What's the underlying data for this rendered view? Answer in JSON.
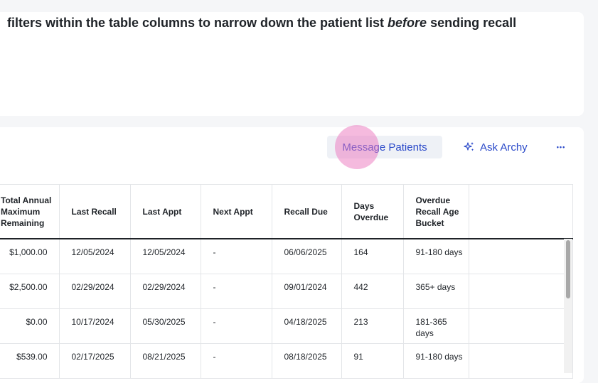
{
  "instruction": {
    "before": "filters within the table columns to narrow down the patient list ",
    "emphasis": "before",
    "after": " sending recall"
  },
  "toolbar": {
    "message_patients": "Message Patients",
    "ask_archy": "Ask Archy",
    "more": "•••"
  },
  "table": {
    "headers": [
      "Total Annual Maximum Remaining",
      "Last Recall",
      "Last Appt",
      "Next Appt",
      "Recall Due",
      "Days Overdue",
      "Overdue Recall Age Bucket",
      ""
    ],
    "rows": [
      [
        "$1,000.00",
        "12/05/2024",
        "12/05/2024",
        "-",
        "06/06/2025",
        "164",
        "91-180 days",
        ""
      ],
      [
        "$2,500.00",
        "02/29/2024",
        "02/29/2024",
        "-",
        "09/01/2024",
        "442",
        "365+ days",
        ""
      ],
      [
        "$0.00",
        "10/17/2024",
        "05/30/2025",
        "-",
        "04/18/2025",
        "213",
        "181-365 days",
        ""
      ],
      [
        "$539.00",
        "02/17/2025",
        "08/21/2025",
        "-",
        "08/18/2025",
        "91",
        "91-180 days",
        ""
      ]
    ]
  },
  "scroll": {
    "position": 0.0
  },
  "colors": {
    "accent": "#2a49c9",
    "button_bg": "#eef1f6",
    "background": "#f5f6f8"
  }
}
